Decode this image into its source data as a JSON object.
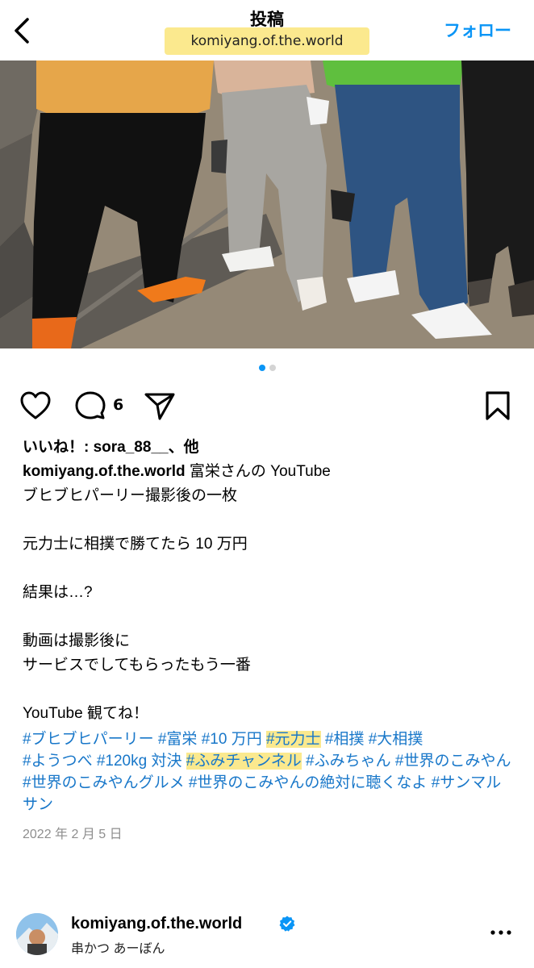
{
  "header": {
    "title": "投稿",
    "subtitle": "komiyang.of.the.world",
    "follow_label": "フォロー",
    "accent_color": "#0a95f6"
  },
  "carousel": {
    "total": 2,
    "current": 1
  },
  "actions": {
    "comment_count": "6"
  },
  "post": {
    "likes_text": "いいね！: sora_88__、他",
    "username": "komiyang.of.the.world",
    "caption_lines": [
      "富栄さんの YouTube",
      "ブヒブヒパーリー撮影後の一枚",
      "",
      "元力士に相撲で勝てたら 10 万円",
      "",
      "結果は…?",
      "",
      "動画は撮影後に",
      "サービスでしてもらったもう一番",
      "",
      "YouTube 観てね！"
    ],
    "hashtags": [
      "#ブヒブヒパーリー",
      "#富栄",
      "#10 万円",
      "#元力士",
      "#相撲",
      "#大相撲",
      "#ようつべ",
      "#120kg 対決",
      "#ふみチャンネル",
      "#ふみちゃん",
      "#世界のこみやん",
      "#世界のこみやんグルメ",
      "#世界のこみやんの絶対に聴くなよ",
      "#サンマルサン"
    ],
    "date": "2022 年 2 月 5 日"
  },
  "profile": {
    "name": "komiyang.of.the.world",
    "subtitle": "串かつ あーぼん"
  },
  "icons": [
    "back-chevron-icon",
    "heart-icon",
    "comment-icon",
    "share-icon",
    "bookmark-icon",
    "verified-badge-icon",
    "more-icon"
  ]
}
